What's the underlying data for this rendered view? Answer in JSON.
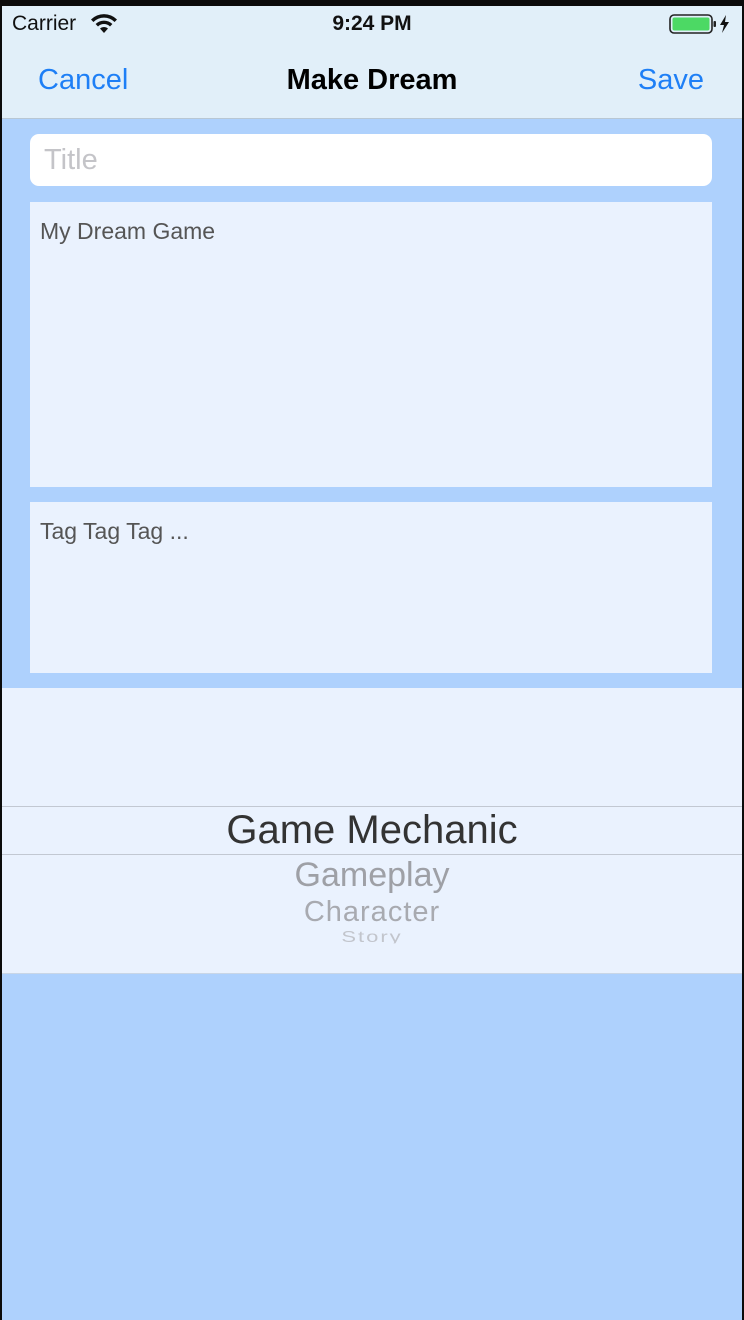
{
  "status_bar": {
    "carrier": "Carrier",
    "time": "9:24 PM",
    "wifi_icon": "wifi-icon",
    "battery_icon": "battery-charging-icon",
    "battery_color": "#4cd964"
  },
  "nav": {
    "cancel_label": "Cancel",
    "title": "Make Dream",
    "save_label": "Save",
    "accent_color": "#1e7ff6"
  },
  "form": {
    "title_placeholder": "Title",
    "title_value": "",
    "description_text": "My Dream Game",
    "tags_text": "Tag Tag Tag ..."
  },
  "picker": {
    "selected": "Game Mechanic",
    "options_below": [
      "Gameplay",
      "Character",
      "Story"
    ]
  },
  "colors": {
    "background": "#aed1fd",
    "field_background": "#eaf2fe",
    "nav_background": "#e1eff9"
  }
}
